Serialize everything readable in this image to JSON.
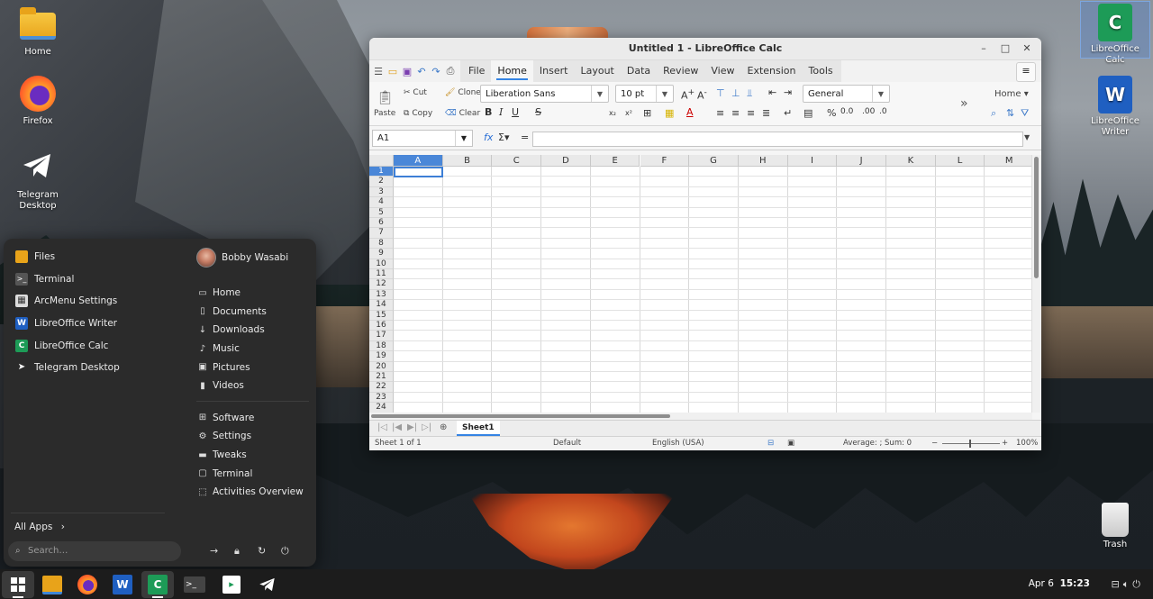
{
  "desktop": {
    "left_icons": [
      {
        "label": "Home",
        "icon": "home-folder-icon"
      },
      {
        "label": "Firefox",
        "icon": "firefox-icon"
      },
      {
        "label": "Telegram Desktop",
        "icon": "telegram-icon"
      }
    ],
    "right_icons": [
      {
        "label": "LibreOffice Calc",
        "icon": "libreoffice-calc-icon"
      },
      {
        "label": "LibreOffice Writer",
        "icon": "libreoffice-writer-icon"
      },
      {
        "label": "Trash",
        "icon": "trash-icon"
      }
    ]
  },
  "calc": {
    "title": "Untitled 1 - LibreOffice Calc",
    "tabs": [
      "File",
      "Home",
      "Insert",
      "Layout",
      "Data",
      "Review",
      "View",
      "Extension",
      "Tools"
    ],
    "active_tab": "Home",
    "ribbon": {
      "paste": "Paste",
      "cut": "Cut",
      "copy": "Copy",
      "clone": "Clone",
      "clear": "Clear",
      "font_name": "Liberation Sans",
      "font_size": "10 pt",
      "number_format": "General",
      "home_dropdown": "Home"
    },
    "name_box": "A1",
    "columns": [
      "A",
      "B",
      "C",
      "D",
      "E",
      "F",
      "G",
      "H",
      "I",
      "J",
      "K",
      "L",
      "M"
    ],
    "rows": [
      "1",
      "2",
      "3",
      "4",
      "5",
      "6",
      "7",
      "8",
      "9",
      "10",
      "11",
      "12",
      "13",
      "14",
      "15",
      "16",
      "17",
      "18",
      "19",
      "20",
      "21",
      "22",
      "23",
      "24"
    ],
    "sheet_tab": "Sheet1",
    "status": {
      "sheet": "Sheet 1 of 1",
      "page_style": "Default",
      "language": "English (USA)",
      "summary": "Average: ; Sum: 0",
      "zoom": "100%"
    }
  },
  "arcmenu": {
    "apps": [
      {
        "label": "Files",
        "icon": "files-icon"
      },
      {
        "label": "Terminal",
        "icon": "terminal-icon"
      },
      {
        "label": "ArcMenu Settings",
        "icon": "arcmenu-settings-icon"
      },
      {
        "label": "LibreOffice Writer",
        "icon": "libreoffice-writer-icon"
      },
      {
        "label": "LibreOffice Calc",
        "icon": "libreoffice-calc-icon"
      },
      {
        "label": "Telegram Desktop",
        "icon": "telegram-icon"
      }
    ],
    "user": "Bobby Wasabi",
    "places": [
      {
        "label": "Home",
        "icon": "home-icon"
      },
      {
        "label": "Documents",
        "icon": "document-icon"
      },
      {
        "label": "Downloads",
        "icon": "download-icon"
      },
      {
        "label": "Music",
        "icon": "music-icon"
      },
      {
        "label": "Pictures",
        "icon": "pictures-icon"
      },
      {
        "label": "Videos",
        "icon": "videos-icon"
      }
    ],
    "system": [
      {
        "label": "Software",
        "icon": "software-icon"
      },
      {
        "label": "Settings",
        "icon": "settings-icon"
      },
      {
        "label": "Tweaks",
        "icon": "tweaks-icon"
      },
      {
        "label": "Terminal",
        "icon": "terminal-icon"
      },
      {
        "label": "Activities Overview",
        "icon": "activities-icon"
      }
    ],
    "all_apps": "All Apps",
    "search_placeholder": "Search…"
  },
  "taskbar": {
    "date": "Apr 6",
    "time": "15:23"
  }
}
